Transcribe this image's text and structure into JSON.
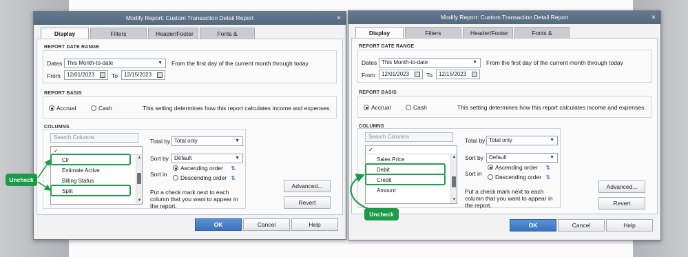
{
  "dialogs": [
    {
      "title": "Modify Report: Custom Transaction Detail Report",
      "close": "×",
      "tabs": [
        "Display",
        "Filters",
        "Header/Footer",
        "Fonts & Numbers"
      ],
      "date_range": {
        "group_label": "REPORT DATE RANGE",
        "dates_label": "Dates",
        "dates_value": "This Month-to-date",
        "dates_desc": "From the first day of the current month through today",
        "from_label": "From",
        "from_value": "12/01/2023",
        "to_label": "To",
        "to_value": "12/15/2023"
      },
      "basis": {
        "group_label": "REPORT BASIS",
        "accrual": "Accrual",
        "cash": "Cash",
        "selected": "accrual",
        "desc": "This setting determines how this report calculates income and expenses."
      },
      "columns": {
        "group_label": "COLUMNS",
        "search_placeholder": "Search Columns",
        "header_check": "✓",
        "items": [
          "Clr",
          "Estimate Active",
          "Billing Status",
          "Split"
        ],
        "highlighted": [
          "Clr",
          "Split"
        ],
        "total_by_label": "Total by",
        "total_by_value": "Total only",
        "sort_by_label": "Sort by",
        "sort_by_value": "Default",
        "sort_in_label": "Sort in",
        "ascending": "Ascending order",
        "descending": "Descending order",
        "sort_selected": "ascending",
        "hint": "Put a check mark next to each column that you want to appear in the report."
      },
      "buttons": {
        "advanced": "Advanced...",
        "revert": "Revert",
        "ok": "OK",
        "cancel": "Cancel",
        "help": "Help"
      },
      "callout": "Uncheck"
    },
    {
      "title": "Modify Report: Custom Transaction Detail Report",
      "close": "×",
      "tabs": [
        "Display",
        "Filters",
        "Header/Footer",
        "Fonts & Numbers"
      ],
      "date_range": {
        "group_label": "REPORT DATE RANGE",
        "dates_label": "Dates",
        "dates_value": "This Month-to-date",
        "dates_desc": "From the first day of the current month through today",
        "from_label": "From",
        "from_value": "12/01/2023",
        "to_label": "To",
        "to_value": "12/15/2023"
      },
      "basis": {
        "group_label": "REPORT BASIS",
        "accrual": "Accrual",
        "cash": "Cash",
        "selected": "accrual",
        "desc": "This setting determines how this report calculates income and expenses."
      },
      "columns": {
        "group_label": "COLUMNS",
        "search_placeholder": "Search Columns",
        "header_check": "✓",
        "items": [
          "Sales Price",
          "Debit",
          "Credit",
          "Amount"
        ],
        "highlighted": [
          "Debit",
          "Credit"
        ],
        "total_by_label": "Total by",
        "total_by_value": "Total only",
        "sort_by_label": "Sort by",
        "sort_by_value": "Default",
        "sort_in_label": "Sort in",
        "ascending": "Ascending order",
        "descending": "Descending order",
        "sort_selected": "ascending",
        "hint": "Put a check mark next to each column that you want to appear in the report."
      },
      "buttons": {
        "advanced": "Advanced...",
        "revert": "Revert",
        "ok": "OK",
        "cancel": "Cancel",
        "help": "Help"
      },
      "callout": "Uncheck"
    }
  ],
  "colors": {
    "highlight": "#1ea04a",
    "callout_bg": "#1b9b47",
    "ok_button": "#3a72bd",
    "titlebar": "#5d7187"
  },
  "icons": [
    "calendar-icon",
    "dropdown-caret-icon",
    "sort-az-icon",
    "checkmark-icon",
    "scroll-up-icon",
    "scroll-down-icon",
    "close-icon"
  ]
}
